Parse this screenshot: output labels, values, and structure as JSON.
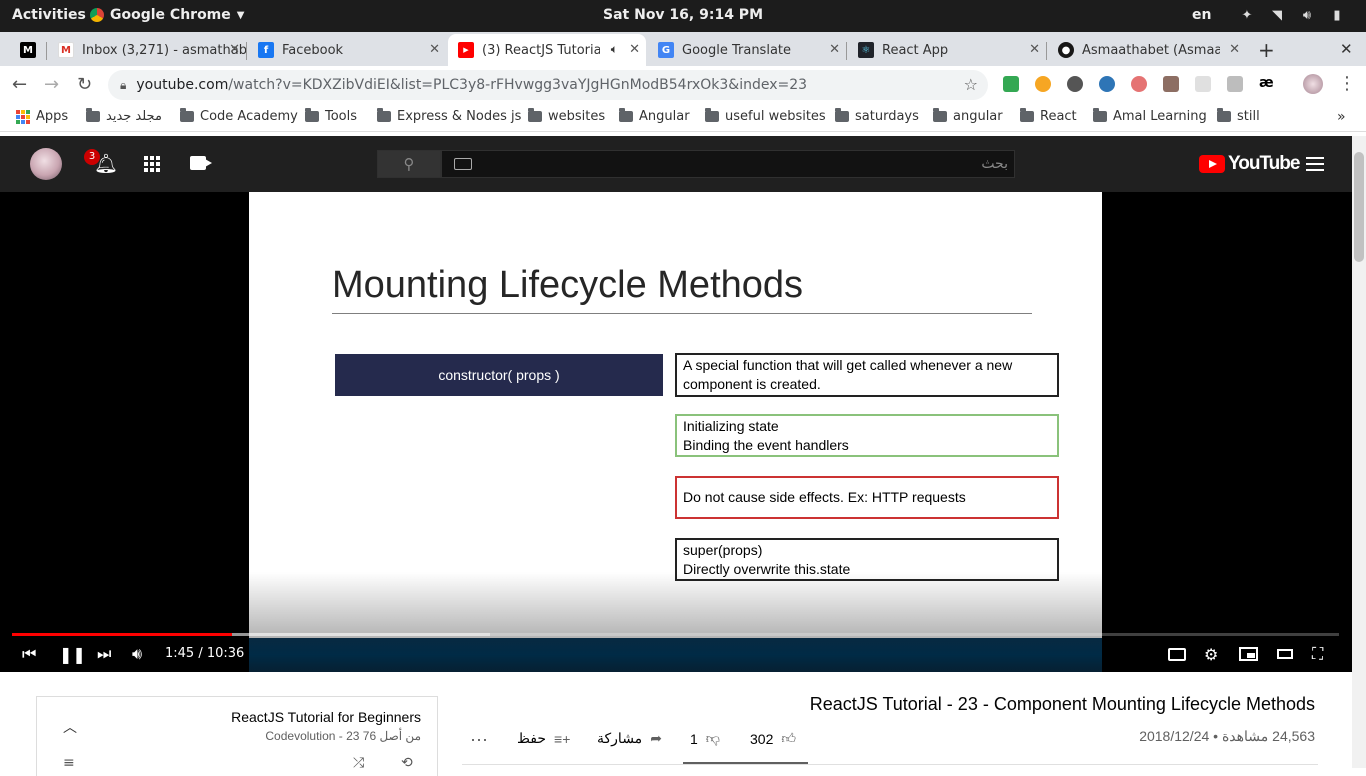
{
  "os": {
    "activities": "Activities",
    "app_name": "Google Chrome",
    "clock": "Sat Nov 16,  9:14 PM",
    "lang": "en"
  },
  "tabs": [
    {
      "title": "",
      "favicon": "medium-icon"
    },
    {
      "title": "Inbox (3,271) - asmathab",
      "favicon": "gmail-icon"
    },
    {
      "title": "Facebook",
      "favicon": "facebook-icon"
    },
    {
      "title": "(3) ReactJS Tutorial",
      "favicon": "youtube-icon",
      "active": true
    },
    {
      "title": "Google Translate",
      "favicon": "google-translate-icon"
    },
    {
      "title": "React App",
      "favicon": "react-icon"
    },
    {
      "title": "Asmaathabet (Asmaa T",
      "favicon": "github-icon"
    }
  ],
  "omnibox": {
    "host": "youtube.com",
    "path": "/watch?v=KDXZibVdiEI&list=PLC3y8-rFHvwgg3vaYJgHGnModB54rxOk3&index=23"
  },
  "bookmarks": [
    "Apps",
    "مجلد جديد",
    "Code Academy",
    "Tools",
    "Express & Nodes js",
    "websites",
    "Angular",
    "useful websites",
    "saturdays",
    "angular",
    "React",
    "Amal Learning",
    "still"
  ],
  "youtube": {
    "notification_count": "3",
    "search_placeholder": "بحث",
    "logo_text": "YouTube"
  },
  "slide": {
    "title": "Mounting Lifecycle Methods",
    "method": "constructor( props )",
    "boxes": [
      {
        "lines": [
          "A special function that will get called whenever a new",
          "component is created."
        ]
      },
      {
        "lines": [
          "Initializing state",
          "Binding the event handlers"
        ]
      },
      {
        "lines": [
          "Do not cause side effects. Ex: HTTP requests"
        ]
      },
      {
        "lines": [
          "super(props)",
          "Directly overwrite this.state"
        ]
      }
    ]
  },
  "player": {
    "time": "1:45 / 10:36",
    "progress_fraction": 0.166,
    "buffered_fraction": 0.36
  },
  "video": {
    "title": "ReactJS Tutorial - 23 - Component Mounting Lifecycle Methods",
    "views_date": "24,563 مشاهدة • 2018/12/24",
    "likes": "302",
    "dislikes": "1",
    "share": "مشاركة",
    "save": "حفظ"
  },
  "playlist": {
    "title": "ReactJS Tutorial for Beginners",
    "subtitle": "Codevolution - 23 من أصل 76"
  },
  "colors": {
    "youtube_red": "#ff0000",
    "masthead": "#202020",
    "slide_method_bg": "#252a4d"
  }
}
